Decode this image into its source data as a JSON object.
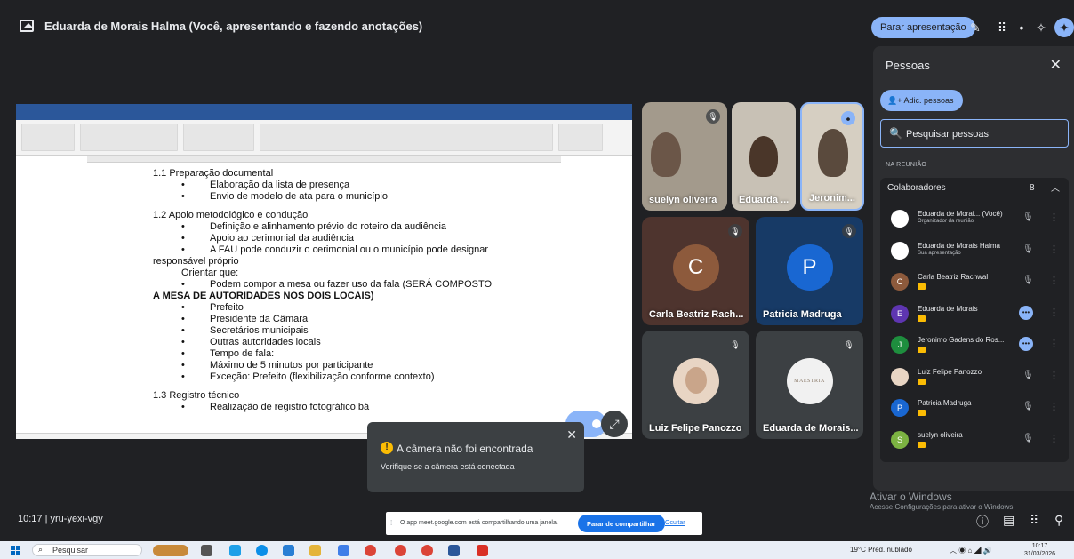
{
  "topbar": {
    "presenter_title": "Eduarda de Morais Halma (Você, apresentando e fazendo anotações)",
    "stop_presenting_label": "Parar apresentação"
  },
  "document": {
    "lines": [
      {
        "text": "1.1 Preparação documental",
        "bold": false,
        "indent": 0
      },
      {
        "text": "Elaboração da lista de presença",
        "bold": false,
        "indent": 1
      },
      {
        "text": "Envio de modelo de ata para o município",
        "bold": false,
        "indent": 1
      },
      {
        "text": "",
        "bold": false,
        "indent": 0
      },
      {
        "text": "1.2 Apoio metodológico e condução",
        "bold": false,
        "indent": 0
      },
      {
        "text": "Definição e alinhamento prévio do roteiro da audiência",
        "bold": false,
        "indent": 1
      },
      {
        "text": "Apoio ao cerimonial da audiência",
        "bold": false,
        "indent": 1
      },
      {
        "text": "A FAU pode conduzir o cerimonial ou o município pode designar",
        "bold": false,
        "indent": 1
      },
      {
        "text": "responsável próprio",
        "bold": false,
        "indent": 0
      },
      {
        "text": "Orientar que:",
        "bold": false,
        "indent": 2
      },
      {
        "text": "Podem compor a mesa ou fazer uso da fala (SERÁ COMPOSTO",
        "bold": false,
        "indent": 1
      },
      {
        "text": "A MESA DE AUTORIDADES NOS DOIS LOCAIS)",
        "bold": true,
        "indent": 0
      },
      {
        "text": "Prefeito",
        "bold": false,
        "indent": 1
      },
      {
        "text": "Presidente da Câmara",
        "bold": false,
        "indent": 1
      },
      {
        "text": "Secretários municipais",
        "bold": false,
        "indent": 1
      },
      {
        "text": "Outras autoridades locais",
        "bold": false,
        "indent": 1
      },
      {
        "text": "Tempo de fala:",
        "bold": false,
        "indent": 1
      },
      {
        "text": "Máximo de 5 minutos por participante",
        "bold": false,
        "indent": 1
      },
      {
        "text": "Exceção: Prefeito (flexibilização conforme contexto)",
        "bold": false,
        "indent": 1
      },
      {
        "text": "",
        "bold": false,
        "indent": 0
      },
      {
        "text": "1.3 Registro técnico",
        "bold": false,
        "indent": 0
      },
      {
        "text": "Realização de registro fotográfico bá",
        "bold": false,
        "indent": 1
      }
    ]
  },
  "tiles": [
    {
      "name": "suelyn oliveira"
    },
    {
      "name": "Eduarda ..."
    },
    {
      "name": "Jeronim..."
    },
    {
      "name": "Carla Beatriz Rach...",
      "initial": "C",
      "color": "#8d5a3c"
    },
    {
      "name": "Patricia Madruga",
      "initial": "P",
      "color": "#1967d2"
    },
    {
      "name": "Luiz Felipe Panozzo"
    },
    {
      "name": "Eduarda de Morais...",
      "logo_text": "MAESTRIA"
    }
  ],
  "toast": {
    "title": "A câmera não foi encontrada",
    "message": "Verifique se a câmera está conectada"
  },
  "people_panel": {
    "title": "Pessoas",
    "add_label": "Adic. pessoas",
    "search_placeholder": "Pesquisar pessoas",
    "in_meeting_label": "NA REUNIÃO",
    "group_label": "Colaboradores",
    "group_count": "8",
    "participants": [
      {
        "name": "Eduarda de Morai... (Você)",
        "role": "Organizador da reunião",
        "initial": "",
        "color": "#ffffff",
        "state": "muted"
      },
      {
        "name": "Eduarda de Morais Halma",
        "role": "Sua apresentação",
        "initial": "",
        "color": "#ffffff",
        "state": "muted"
      },
      {
        "name": "Carla Beatriz Rachwal",
        "role": "",
        "initial": "C",
        "color": "#8d5a3c",
        "state": "muted"
      },
      {
        "name": "Eduarda de Morais",
        "role": "",
        "initial": "E",
        "color": "#5e35b1",
        "state": "speaking"
      },
      {
        "name": "Jeronimo Gadens do Ros...",
        "role": "",
        "initial": "J",
        "color": "#1e8e3e",
        "state": "speaking"
      },
      {
        "name": "Luiz Felipe Panozzo",
        "role": "",
        "initial": "",
        "color": "#e8d5c4",
        "state": "muted"
      },
      {
        "name": "Patricia Madruga",
        "role": "",
        "initial": "P",
        "color": "#1967d2",
        "state": "muted"
      },
      {
        "name": "suelyn oliveira",
        "role": "",
        "initial": "S",
        "color": "#7cb342",
        "state": "muted"
      }
    ]
  },
  "bottom": {
    "meeting_info": "10:17  |  yru-yexi-vgy",
    "share_text": "O app meet.google.com está compartilhando uma janela.",
    "stop_sharing_label": "Parar de compartilhar",
    "hide_label": "Ocultar",
    "windows_activation_title": "Ativar o Windows",
    "windows_activation_msg": "Acesse Configurações para ativar o Windows."
  },
  "taskbar": {
    "search_label": "Pesquisar",
    "weather": "19°C  Pred. nublado",
    "time": "10:17",
    "date": "31/03/2026"
  },
  "colors": {
    "accent": "#8ab4f8",
    "background": "#202124",
    "word_blue": "#2b579a",
    "warning": "#fbbc04"
  }
}
